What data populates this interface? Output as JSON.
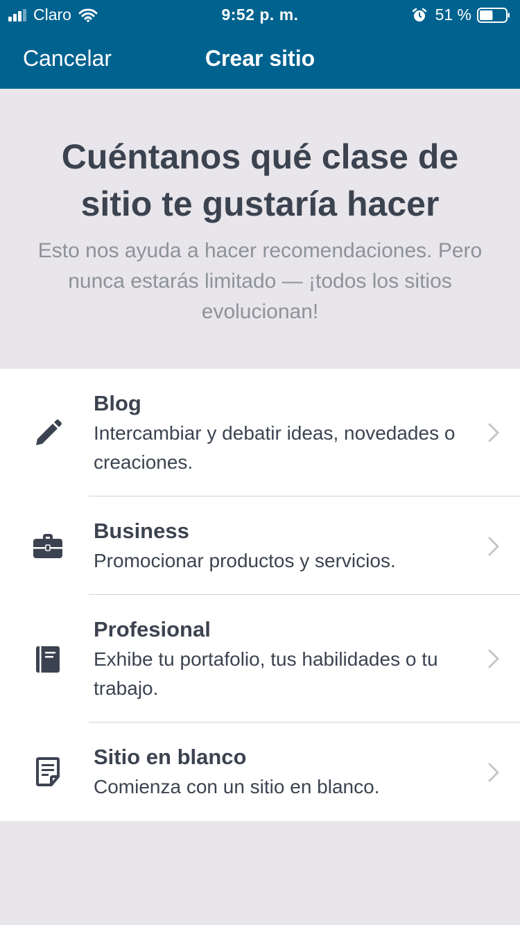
{
  "status_bar": {
    "carrier": "Claro",
    "time": "9:52 p. m.",
    "battery_percent": "51 %",
    "battery_level": 0.51,
    "signal_bars": 3,
    "signal_total": 4,
    "icons": [
      "signal-icon",
      "wifi-icon",
      "alarm-icon",
      "battery-icon"
    ]
  },
  "nav": {
    "cancel_label": "Cancelar",
    "title": "Crear sitio"
  },
  "intro": {
    "heading": "Cuéntanos qué clase de sitio te gustaría hacer",
    "subtext": "Esto nos ayuda a hacer recomendaciones. Pero nunca estarás limitado — ¡todos los sitios evolucionan!"
  },
  "site_types": [
    {
      "icon": "pencil-icon",
      "title": "Blog",
      "description": "Intercambiar y debatir ideas, novedades o creaciones."
    },
    {
      "icon": "briefcase-icon",
      "title": "Business",
      "description": "Promocionar productos y servicios."
    },
    {
      "icon": "book-icon",
      "title": "Profesional",
      "description": "Exhibe tu portafolio, tus habilidades o tu trabajo."
    },
    {
      "icon": "page-icon",
      "title": "Sitio en blanco",
      "description": "Comienza con un sitio en blanco."
    }
  ],
  "colors": {
    "header_bg": "#00628f",
    "page_bg": "#e8e6ea",
    "list_bg": "#ffffff",
    "text_dark": "#3c4350",
    "text_muted": "#8d9299",
    "chevron": "#c3c5c9"
  }
}
